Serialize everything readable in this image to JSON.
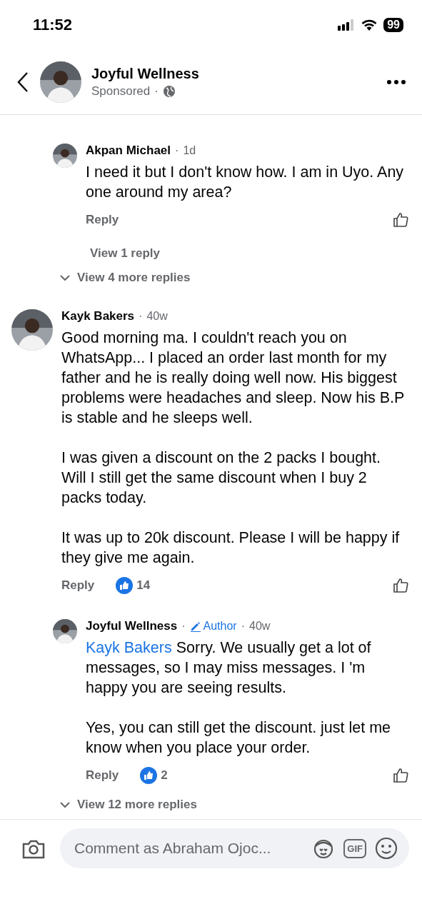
{
  "status_bar": {
    "time": "11:52",
    "battery": "99"
  },
  "header": {
    "title": "Joyful Wellness",
    "subtitle": "Sponsored",
    "separator": "·"
  },
  "comments": [
    {
      "kind": "reply",
      "name": "Akpan Michael",
      "separator": "·",
      "time": "1d",
      "author": false,
      "paragraphs": [
        {
          "text": "I need it but I don't know how. I am in Uyo. Any one around my area?"
        }
      ],
      "reply_label": "Reply",
      "view_replies": "View 1 reply"
    },
    {
      "kind": "more",
      "label": "View 4 more replies"
    },
    {
      "kind": "top",
      "name": "Kayk Bakers",
      "separator": "·",
      "time": "40w",
      "author": false,
      "paragraphs": [
        {
          "text": "Good morning ma. I couldn't reach you on WhatsApp... I placed an order  last month for my father and he is really doing well now. His biggest problems were headaches and sleep. Now his B.P is stable and he sleeps well."
        },
        {
          "text": "I was given a discount on the 2 packs I bought. Will I still get the same discount when I buy 2 packs today."
        },
        {
          "text": "It was up to 20k discount. Please I will be happy if they give me again."
        }
      ],
      "reply_label": "Reply",
      "likes": "14"
    },
    {
      "kind": "reply",
      "name": "Joyful Wellness",
      "separator": "·",
      "time": "40w",
      "author": true,
      "author_label": "Author",
      "paragraphs": [
        {
          "mention": "Kayk Bakers",
          "text": "Sorry. We usually get a lot of messages, so I may miss messages. I 'm happy you are seeing results."
        },
        {
          "text": "Yes, you can still get the discount. just let me know when you place your order."
        }
      ],
      "reply_label": "Reply",
      "likes": "2"
    },
    {
      "kind": "more",
      "label": "View 12 more replies"
    }
  ],
  "composer": {
    "placeholder": "Comment as Abraham Ojoc...",
    "gif_label": "GIF"
  }
}
